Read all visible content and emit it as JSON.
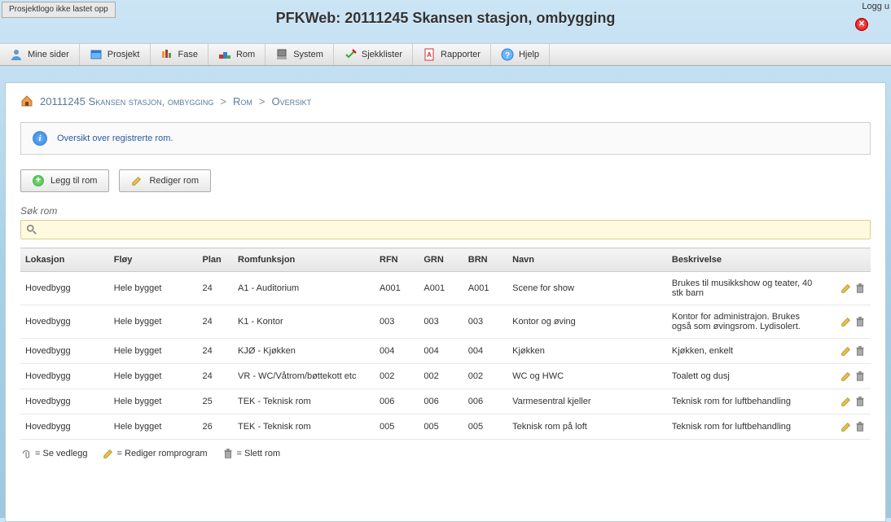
{
  "logo_placeholder": "Prosjektlogo\nikke lastet opp",
  "header_title": "PFKWeb: 20111245 Skansen stasjon, ombygging",
  "logout_label": "Logg u",
  "menu": [
    {
      "label": "Mine sider",
      "icon": "user"
    },
    {
      "label": "Prosjekt",
      "icon": "project"
    },
    {
      "label": "Fase",
      "icon": "phase"
    },
    {
      "label": "Rom",
      "icon": "room"
    },
    {
      "label": "System",
      "icon": "system"
    },
    {
      "label": "Sjekklister",
      "icon": "checklist"
    },
    {
      "label": "Rapporter",
      "icon": "report"
    },
    {
      "label": "Hjelp",
      "icon": "help"
    }
  ],
  "breadcrumb": {
    "root": "20111245 Skansen stasjon, ombygging",
    "mid": "Rom",
    "leaf": "Oversikt"
  },
  "info_text": "Oversikt over registrerte rom.",
  "buttons": {
    "add": "Legg til rom",
    "edit": "Rediger rom"
  },
  "search_label": "Søk rom",
  "columns": {
    "lokasjon": "Lokasjon",
    "floy": "Fløy",
    "plan": "Plan",
    "romfunksjon": "Romfunksjon",
    "rfn": "RFN",
    "grn": "GRN",
    "brn": "BRN",
    "navn": "Navn",
    "beskrivelse": "Beskrivelse"
  },
  "rows": [
    {
      "lokasjon": "Hovedbygg",
      "floy": "Hele bygget",
      "plan": "24",
      "romfunksjon": "A1 - Auditorium",
      "rfn": "A001",
      "grn": "A001",
      "brn": "A001",
      "navn": "Scene for show",
      "beskrivelse": "Brukes til musikkshow og teater, 40 stk barn"
    },
    {
      "lokasjon": "Hovedbygg",
      "floy": "Hele bygget",
      "plan": "24",
      "romfunksjon": "K1 - Kontor",
      "rfn": "003",
      "grn": "003",
      "brn": "003",
      "navn": "Kontor og øving",
      "beskrivelse": "Kontor for administrajon. Brukes også som øvingsrom. Lydisolert."
    },
    {
      "lokasjon": "Hovedbygg",
      "floy": "Hele bygget",
      "plan": "24",
      "romfunksjon": "KJØ - Kjøkken",
      "rfn": "004",
      "grn": "004",
      "brn": "004",
      "navn": "Kjøkken",
      "beskrivelse": "Kjøkken, enkelt"
    },
    {
      "lokasjon": "Hovedbygg",
      "floy": "Hele bygget",
      "plan": "24",
      "romfunksjon": "VR - WC/Våtrom/bøttekott etc",
      "rfn": "002",
      "grn": "002",
      "brn": "002",
      "navn": "WC og HWC",
      "beskrivelse": "Toalett og dusj"
    },
    {
      "lokasjon": "Hovedbygg",
      "floy": "Hele bygget",
      "plan": "25",
      "romfunksjon": "TEK - Teknisk rom",
      "rfn": "006",
      "grn": "006",
      "brn": "006",
      "navn": "Varmesentral kjeller",
      "beskrivelse": "Teknisk rom for luftbehandling"
    },
    {
      "lokasjon": "Hovedbygg",
      "floy": "Hele bygget",
      "plan": "26",
      "romfunksjon": "TEK - Teknisk rom",
      "rfn": "005",
      "grn": "005",
      "brn": "005",
      "navn": "Teknisk rom på loft",
      "beskrivelse": "Teknisk rom for luftbehandling"
    }
  ],
  "legend": {
    "attachment": "= Se vedlegg",
    "edit": "= Rediger romprogram",
    "delete": "= Slett rom"
  }
}
